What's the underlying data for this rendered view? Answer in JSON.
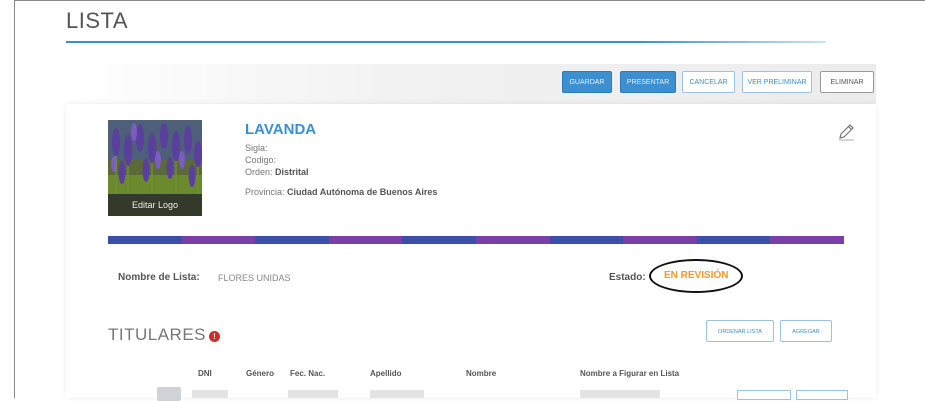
{
  "header": {
    "title": "LISTA"
  },
  "toolbar": {
    "buttons": [
      {
        "label": "GUARDAR",
        "variant": "primary"
      },
      {
        "label": "PRESENTAR",
        "variant": "primary"
      },
      {
        "label": "CANCELAR",
        "variant": "default"
      },
      {
        "label": "VER PRELIMINAR",
        "variant": "default"
      },
      {
        "label": "ELIMINAR",
        "variant": "plain"
      }
    ]
  },
  "party": {
    "logo_caption": "Editar Logo",
    "name": "LAVANDA",
    "sigla_label": "Sigla:",
    "codigo_label": "Codigo:",
    "orden_label": "Orden:",
    "orden_value": "Distrital",
    "provincia_label": "Provincia:",
    "provincia_value": "Ciudad Autónoma de Buenos Aires"
  },
  "stripe_colors": [
    "#3b4fa8",
    "#7b3fa8",
    "#3b4fa8",
    "#7b3fa8",
    "#3b4fa8",
    "#7b3fa8",
    "#3b4fa8",
    "#7b3fa8",
    "#3b4fa8",
    "#7b3fa8"
  ],
  "list_info": {
    "name_label": "Nombre de Lista:",
    "name_value": "FLORES UNIDAS",
    "estado_label": "Estado:",
    "estado_value": "EN REVISIÓN"
  },
  "titulares": {
    "title": "TITULARES",
    "alert": "!",
    "buttons": [
      "ORDENAR LISTA",
      "AGREGAR"
    ],
    "columns": [
      "DNI",
      "Género",
      "Fec. Nac.",
      "Apellido",
      "Nombre",
      "Nombre a Figurar en Lista"
    ]
  },
  "colors": {
    "accent": "#3a8ed4",
    "status": "#f39a2e",
    "alert": "#d9262c"
  }
}
